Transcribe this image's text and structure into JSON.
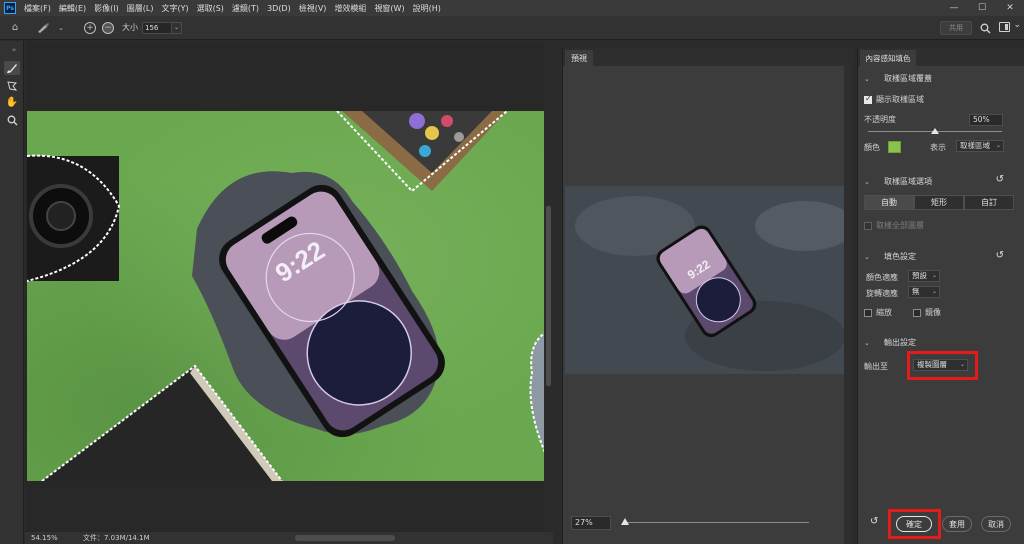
{
  "menubar": {
    "logo": "Ps",
    "items": [
      "檔案(F)",
      "編輯(E)",
      "影像(I)",
      "圖層(L)",
      "文字(Y)",
      "選取(S)",
      "濾鏡(T)",
      "3D(D)",
      "檢視(V)",
      "增效模組",
      "視窗(W)",
      "說明(H)"
    ],
    "window_controls": [
      "—",
      "☐",
      "✕"
    ]
  },
  "optionsbar": {
    "size_label": "大小",
    "size_value": "156",
    "share_label": "共用"
  },
  "canvas": {
    "zoom": "54.15%",
    "doc_info": "文件：7.03M/14.1M"
  },
  "preview": {
    "tab_label": "預視",
    "zoom": "27%"
  },
  "properties": {
    "tab_label": "內容感知填色",
    "section_overlay": "取樣區域覆蓋",
    "show_sampling": "顯示取樣區域",
    "opacity_label": "不透明度",
    "opacity_value": "50%",
    "color_label": "顏色",
    "show_label": "表示",
    "show_value": "取樣區域",
    "section_sampling": "取樣區域選項",
    "seg_auto": "自動",
    "seg_rect": "矩形",
    "seg_custom": "自訂",
    "sample_all_layers": "取樣全部圖層",
    "section_fill": "填色設定",
    "color_adapt_label": "顏色適應",
    "color_adapt_value": "預設",
    "rotation_adapt_label": "旋轉適應",
    "rotation_adapt_value": "無",
    "scale_label": "縮放",
    "mirror_label": "鏡像",
    "section_output": "輸出設定",
    "output_to_label": "輸出至",
    "output_to_value": "複製圖層",
    "ok_label": "確定",
    "apply_label": "套用",
    "cancel_label": "取消"
  },
  "highlight_color": "#e31b1b",
  "icons": [
    "home-icon",
    "brush-icon",
    "plus-circle-icon",
    "minus-circle-icon",
    "search-icon",
    "workspace-icon",
    "lasso-icon",
    "hand-icon",
    "zoom-icon",
    "reset-icon",
    "chevron-down-icon"
  ]
}
